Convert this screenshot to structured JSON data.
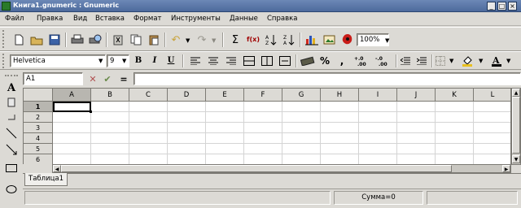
{
  "window": {
    "title": "Книга1.gnumeric : Gnumeric"
  },
  "menu": [
    "Файл",
    "Правка",
    "Вид",
    "Вставка",
    "Формат",
    "Инструменты",
    "Данные",
    "Справка"
  ],
  "toolbar": {
    "zoom": "100%"
  },
  "format_toolbar": {
    "font_name": "Helvetica",
    "font_size": "9",
    "bold_label": "B",
    "italic_label": "I",
    "underline_label": "U",
    "percent_label": "%",
    "comma_label": ","
  },
  "formula_bar": {
    "cell_ref": "A1",
    "equals_label": "="
  },
  "sheet": {
    "columns": [
      "A",
      "B",
      "C",
      "D",
      "E",
      "F",
      "G",
      "H",
      "I",
      "J",
      "K",
      "L"
    ],
    "rows": [
      "1",
      "2",
      "3",
      "4",
      "5",
      "6"
    ],
    "selected_cell": "A1"
  },
  "tabs": [
    "Таблица1"
  ],
  "status": {
    "sum": "Сумма=0"
  },
  "colors": {
    "title_bar": "#5a76a8",
    "chrome": "#dcdad5",
    "tab_active": "#f0efec",
    "selection": "#000000"
  }
}
